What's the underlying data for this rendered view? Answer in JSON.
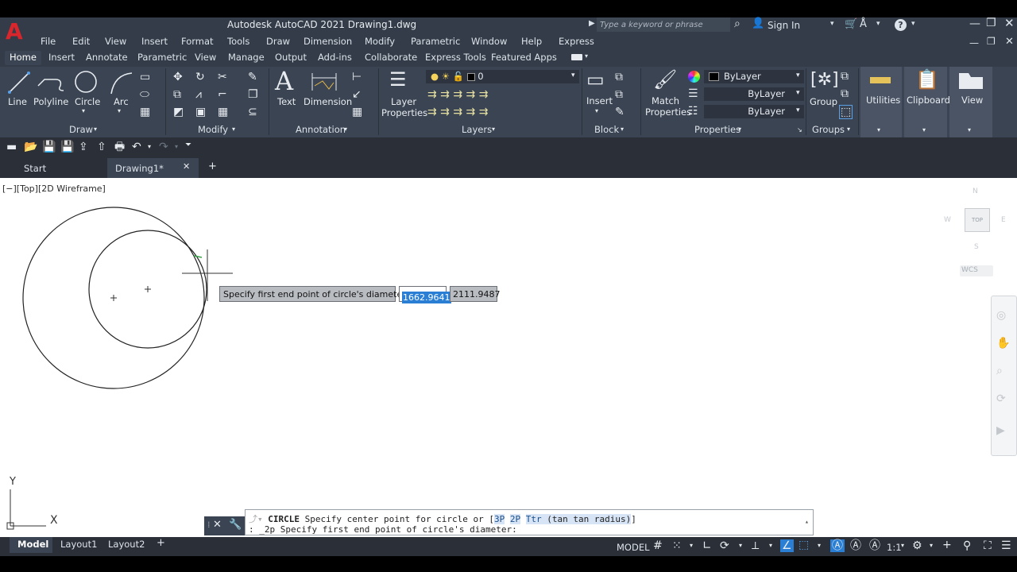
{
  "app": {
    "title": "Autodesk AutoCAD 2021    Drawing1.dwg",
    "logo_letter": "A"
  },
  "search": {
    "placeholder": "Type a keyword or phrase",
    "sign_in": "Sign In"
  },
  "menu": [
    "File",
    "Edit",
    "View",
    "Insert",
    "Format",
    "Tools",
    "Draw",
    "Dimension",
    "Modify",
    "Parametric",
    "Window",
    "Help",
    "Express"
  ],
  "ribbon_tabs": [
    "Home",
    "Insert",
    "Annotate",
    "Parametric",
    "View",
    "Manage",
    "Output",
    "Add-ins",
    "Collaborate",
    "Express Tools",
    "Featured Apps"
  ],
  "ribbon": {
    "draw": {
      "line": "Line",
      "polyline": "Polyline",
      "circle": "Circle",
      "arc": "Arc",
      "label": "Draw"
    },
    "modify": {
      "label": "Modify"
    },
    "annotation": {
      "text": "Text",
      "dimension": "Dimension",
      "label": "Annotation"
    },
    "layers": {
      "layer_properties_1": "Layer",
      "layer_properties_2": "Properties",
      "current_layer": "0",
      "label": "Layers"
    },
    "block": {
      "insert": "Insert",
      "label": "Block"
    },
    "properties": {
      "match_1": "Match",
      "match_2": "Properties",
      "color": "ByLayer",
      "linetype": "ByLayer",
      "lineweight": "ByLayer",
      "label": "Properties"
    },
    "groups": {
      "group": "Group",
      "label": "Groups"
    },
    "utilities": "Utilities",
    "clipboard": "Clipboard",
    "view": "View"
  },
  "file_tabs": {
    "start": "Start",
    "drawing": "Drawing1*"
  },
  "viewport": {
    "label": "[−][Top][2D Wireframe]",
    "viewcube_top": "TOP",
    "north": "N",
    "west": "W",
    "east": "E",
    "south": "S",
    "wcs": "WCS"
  },
  "dynamic_input": {
    "prompt": "Specify first end point of circle's diameter:",
    "x_value": "1662.9641",
    "y_value": "2111.9487"
  },
  "command": {
    "line1_cmd": "CIRCLE",
    "line1_text": " Specify center point for circle or [",
    "opt1": "3P",
    "opt2": "2P",
    "opt3": "Ttr",
    "opt3_rest": " (tan tan radius)",
    "line1_end": "]",
    "line2": ": _2p Specify first end point of circle's diameter:"
  },
  "ucs": {
    "x": "X",
    "y": "Y"
  },
  "layout_tabs": [
    "Model",
    "Layout1",
    "Layout2"
  ],
  "status": {
    "model": "MODEL",
    "scale": "1:1"
  },
  "colors": {
    "accent": "#d8262c",
    "ribbon_bg": "#3b4453",
    "highlight": "#2a7fd4"
  }
}
